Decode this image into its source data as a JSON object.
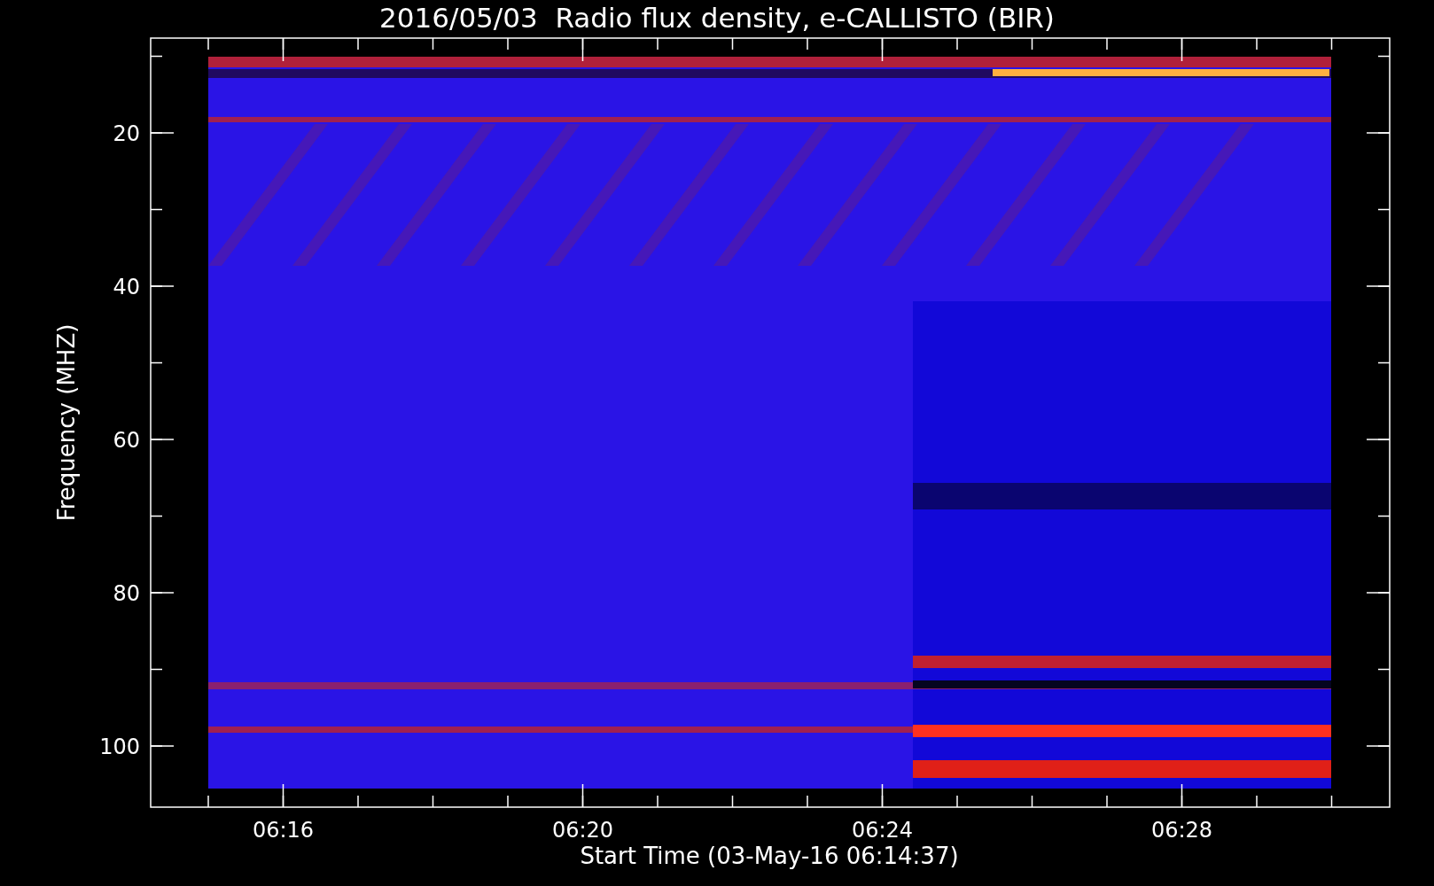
{
  "title": "2016/05/03  Radio flux density, e-CALLISTO (BIR)",
  "plot": {
    "ylabel": "Frequency (MHZ)",
    "xlabel": "Start Time (03-May-16 06:14:37)",
    "yticks": [
      "20",
      "40",
      "60",
      "80",
      "100"
    ],
    "xticks": [
      "06:16",
      "06:20",
      "06:24",
      "06:28"
    ]
  }
}
